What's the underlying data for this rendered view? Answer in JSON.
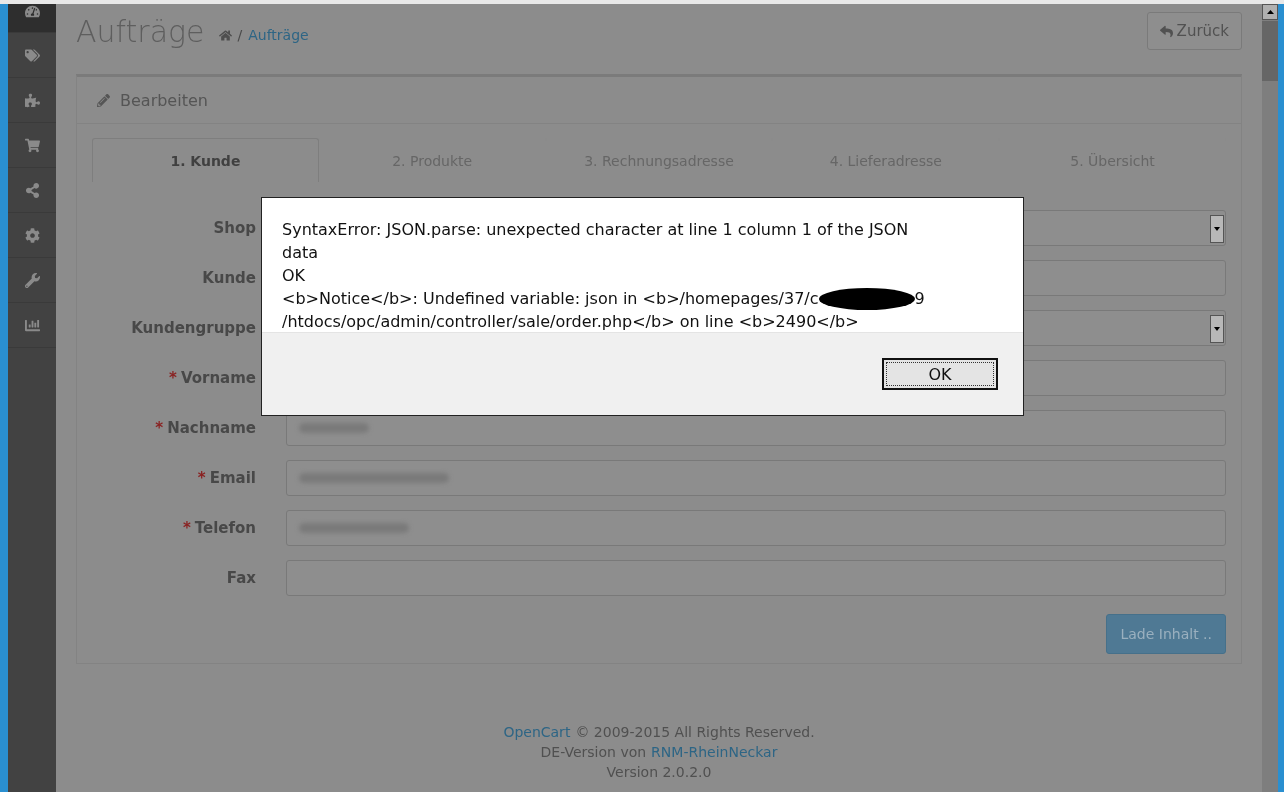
{
  "sidebar": {
    "items": [
      {
        "selected": true
      },
      {
        "selected": false
      },
      {
        "selected": false
      },
      {
        "selected": false
      },
      {
        "selected": false
      },
      {
        "selected": false
      },
      {
        "selected": false
      },
      {
        "selected": false
      }
    ]
  },
  "header": {
    "title": "Aufträge",
    "breadcrumb_separator": "/",
    "breadcrumb": "Aufträge",
    "back_button": "Zurück"
  },
  "panel": {
    "heading": "Bearbeiten",
    "tabs": [
      {
        "label": "1. Kunde",
        "selected": true
      },
      {
        "label": "2. Produkte",
        "selected": false
      },
      {
        "label": "3. Rechnungsadresse",
        "selected": false
      },
      {
        "label": "4. Lieferadresse",
        "selected": false
      },
      {
        "label": "5. Übersicht",
        "selected": false
      }
    ],
    "fields": [
      {
        "label": "Shop",
        "kind": "select"
      },
      {
        "label": "Kunde",
        "kind": "input"
      },
      {
        "label": "Kundengruppe",
        "kind": "select"
      },
      {
        "required_mark": "*",
        "label": "Vorname",
        "kind": "input"
      },
      {
        "required_mark": "*",
        "label": "Nachname",
        "kind": "blurred"
      },
      {
        "required_mark": "*",
        "label": "Email",
        "kind": "blurred"
      },
      {
        "required_mark": "*",
        "label": "Telefon",
        "kind": "blurred"
      },
      {
        "label": "Fax",
        "kind": "input"
      }
    ],
    "load_button": "Lade Inhalt .."
  },
  "footer": {
    "line1_link": "OpenCart",
    "line1_text": "© 2009-2015 All Rights Reserved.",
    "line2_text": "DE-Version von",
    "line2_link": "RNM-RheinNeckar",
    "line3": "Version 2.0.2.0"
  },
  "dialog": {
    "lines": [
      {
        "text": "SyntaxError: JSON.parse: unexpected character at line 1 column 1 of the JSON",
        "redacted": false
      },
      {
        "text": "data",
        "redacted": false
      },
      {
        "text": "OK",
        "redacted": false
      },
      {
        "text": "<b>Notice</b>: Undefined variable: json in <b>/homepages/37/c",
        "redacted": true,
        "after": "9"
      },
      {
        "text": "/htdocs/opc/admin/controller/sale/order.php</b> on line <b>2490</b>",
        "redacted": false
      }
    ],
    "ok_button": "OK"
  }
}
